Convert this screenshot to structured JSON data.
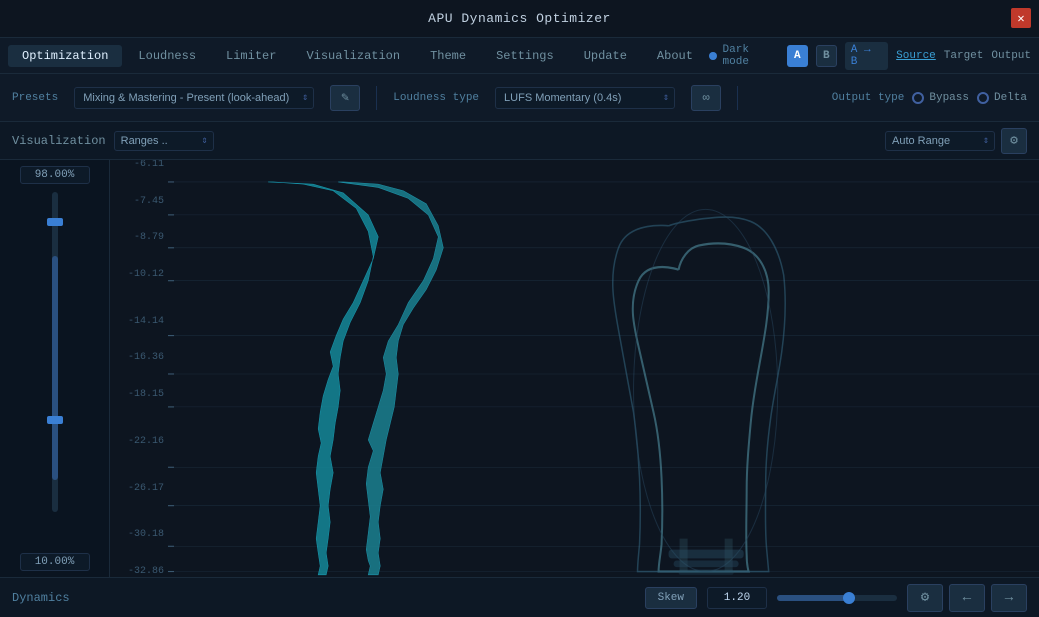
{
  "window": {
    "title": "APU Dynamics Optimizer"
  },
  "nav": {
    "tabs": [
      {
        "id": "optimization",
        "label": "Optimization",
        "active": true
      },
      {
        "id": "loudness",
        "label": "Loudness",
        "active": false
      },
      {
        "id": "limiter",
        "label": "Limiter",
        "active": false
      },
      {
        "id": "visualization",
        "label": "Visualization",
        "active": false
      },
      {
        "id": "theme",
        "label": "Theme",
        "active": false
      },
      {
        "id": "settings",
        "label": "Settings",
        "active": false
      },
      {
        "id": "update",
        "label": "Update",
        "active": false
      },
      {
        "id": "about",
        "label": "About",
        "active": false
      }
    ],
    "dark_mode_label": "Dark mode",
    "ab_a": "A",
    "ab_b": "B",
    "ab_arrow": "A → B",
    "source": "Source",
    "target": "Target",
    "output": "Output"
  },
  "presets": {
    "label": "Presets",
    "selected": "Mixing & Mastering - Present (look-ahead)",
    "edit_icon": "✎"
  },
  "loudness": {
    "label": "Loudness type",
    "selected": "LUFS Momentary (0.4s)",
    "link_icon": "∞"
  },
  "output_type": {
    "label": "Output type",
    "bypass": "Bypass",
    "delta": "Delta"
  },
  "visualization": {
    "title": "Visualization",
    "range_label": "Ranges ..",
    "auto_range": "Auto Range",
    "gear_icon": "⚙"
  },
  "slider": {
    "top_value": "98.00%",
    "bottom_value": "10.00%",
    "top_thumb_pct": 10,
    "bottom_thumb_pct": 72
  },
  "chart": {
    "labels": [
      "-6.11",
      "-7.45",
      "-8.79",
      "-10.12",
      "-14.14",
      "-16.36",
      "-18.15",
      "-22.16",
      "-26.17",
      "-30.18",
      "-32.86"
    ],
    "gridline_positions": [
      0,
      9,
      17,
      25,
      40,
      50,
      58,
      72,
      82,
      93,
      100
    ]
  },
  "bottom": {
    "dynamics_label": "Dynamics",
    "skew_btn": "Skew",
    "skew_value": "1.20",
    "gear_icon": "⚙",
    "back_icon": "←",
    "forward_icon": "→"
  }
}
